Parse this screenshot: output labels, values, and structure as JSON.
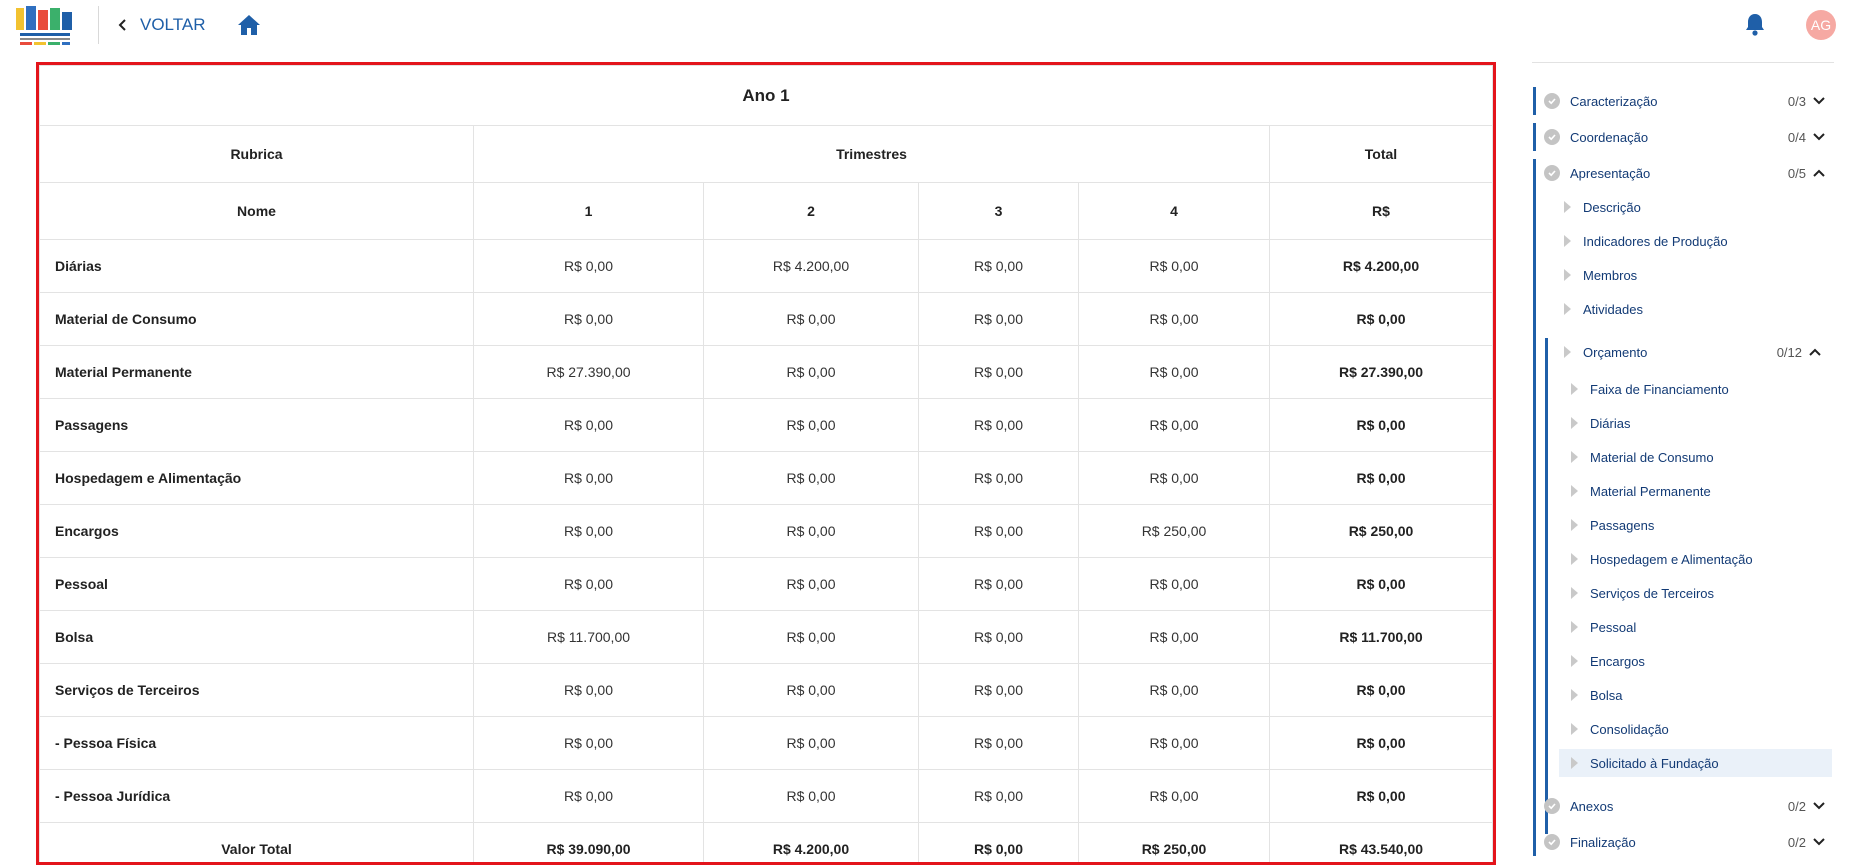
{
  "header": {
    "back_label": "VOLTAR",
    "avatar_initials": "AG",
    "accent_color": "#1f5fa8"
  },
  "budget_table": {
    "year_title": "Ano 1",
    "headers": {
      "rubrica": "Rubrica",
      "trimestres": "Trimestres",
      "total": "Total",
      "nome": "Nome",
      "q1": "1",
      "q2": "2",
      "q3": "3",
      "q4": "4",
      "currency": "R$"
    },
    "rows": [
      {
        "name": "Diárias",
        "q1": "R$ 0,00",
        "q2": "R$ 4.200,00",
        "q3": "R$ 0,00",
        "q4": "R$ 0,00",
        "total": "R$ 4.200,00"
      },
      {
        "name": "Material de Consumo",
        "q1": "R$ 0,00",
        "q2": "R$ 0,00",
        "q3": "R$ 0,00",
        "q4": "R$ 0,00",
        "total": "R$ 0,00"
      },
      {
        "name": "Material Permanente",
        "q1": "R$ 27.390,00",
        "q2": "R$ 0,00",
        "q3": "R$ 0,00",
        "q4": "R$ 0,00",
        "total": "R$ 27.390,00"
      },
      {
        "name": "Passagens",
        "q1": "R$ 0,00",
        "q2": "R$ 0,00",
        "q3": "R$ 0,00",
        "q4": "R$ 0,00",
        "total": "R$ 0,00"
      },
      {
        "name": "Hospedagem e Alimentação",
        "q1": "R$ 0,00",
        "q2": "R$ 0,00",
        "q3": "R$ 0,00",
        "q4": "R$ 0,00",
        "total": "R$ 0,00"
      },
      {
        "name": "Encargos",
        "q1": "R$ 0,00",
        "q2": "R$ 0,00",
        "q3": "R$ 0,00",
        "q4": "R$ 250,00",
        "total": "R$ 250,00"
      },
      {
        "name": "Pessoal",
        "q1": "R$ 0,00",
        "q2": "R$ 0,00",
        "q3": "R$ 0,00",
        "q4": "R$ 0,00",
        "total": "R$ 0,00"
      },
      {
        "name": "Bolsa",
        "q1": "R$ 11.700,00",
        "q2": "R$ 0,00",
        "q3": "R$ 0,00",
        "q4": "R$ 0,00",
        "total": "R$ 11.700,00"
      },
      {
        "name": "Serviços de Terceiros",
        "q1": "R$ 0,00",
        "q2": "R$ 0,00",
        "q3": "R$ 0,00",
        "q4": "R$ 0,00",
        "total": "R$ 0,00"
      },
      {
        "name": "- Pessoa Física",
        "q1": "R$ 0,00",
        "q2": "R$ 0,00",
        "q3": "R$ 0,00",
        "q4": "R$ 0,00",
        "total": "R$ 0,00"
      },
      {
        "name": "- Pessoa Jurídica",
        "q1": "R$ 0,00",
        "q2": "R$ 0,00",
        "q3": "R$ 0,00",
        "q4": "R$ 0,00",
        "total": "R$ 0,00"
      }
    ],
    "sum_row": {
      "name": "Valor Total",
      "q1": "R$ 39.090,00",
      "q2": "R$ 4.200,00",
      "q3": "R$ 0,00",
      "q4": "R$ 250,00",
      "total": "R$ 43.540,00"
    },
    "highlight_border_color": "#e3141b"
  },
  "sidebar": {
    "sections": [
      {
        "label": "Caracterização",
        "count": "0/3",
        "expanded": false
      },
      {
        "label": "Coordenação",
        "count": "0/4",
        "expanded": false
      },
      {
        "label": "Apresentação",
        "count": "0/5",
        "expanded": true
      },
      {
        "label": "Anexos",
        "count": "0/2",
        "expanded": false
      },
      {
        "label": "Finalização",
        "count": "0/2",
        "expanded": false
      }
    ],
    "apresentacao_items": [
      "Descrição",
      "Indicadores de Produção",
      "Membros",
      "Atividades"
    ],
    "orcamento": {
      "label": "Orçamento",
      "count": "0/12",
      "expanded": true
    },
    "orcamento_items": [
      "Faixa de Financiamento",
      "Diárias",
      "Material de Consumo",
      "Material Permanente",
      "Passagens",
      "Hospedagem e Alimentação",
      "Serviços de Terceiros",
      "Pessoal",
      "Encargos",
      "Bolsa",
      "Consolidação",
      "Solicitado à Fundação"
    ],
    "active_item": "Solicitado à Fundação"
  }
}
